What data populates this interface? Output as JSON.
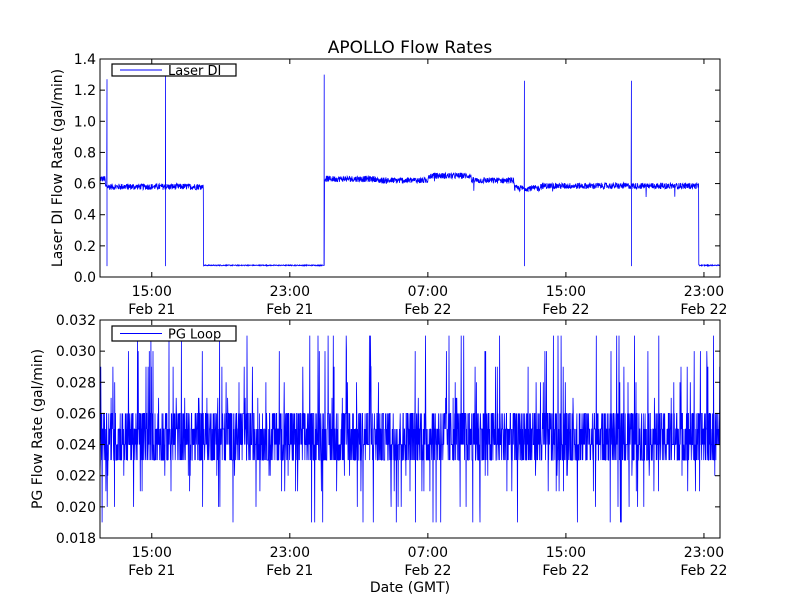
{
  "figure_title": "APOLLO Flow Rates",
  "xlabel": "Date (GMT)",
  "colors": {
    "series": "#0000ff",
    "axes": "#000000",
    "background": "#ffffff"
  },
  "chart_data": [
    {
      "type": "line",
      "title": "APOLLO Flow Rates",
      "ylabel": "Laser DI Flow Rate (gal/min)",
      "legend": {
        "label": "Laser DI",
        "placement": "top-left"
      },
      "xlim_hours": [
        0,
        35.93
      ],
      "x_origin": "Feb 21 12:00",
      "ylim": [
        0.0,
        1.4
      ],
      "yticks": [
        "0.0",
        "0.2",
        "0.4",
        "0.6",
        "0.8",
        "1.0",
        "1.2",
        "1.4"
      ],
      "ytick_values": [
        0,
        0.2,
        0.4,
        0.6,
        0.8,
        1.0,
        1.2,
        1.4
      ],
      "xticks": [
        {
          "hour": 3,
          "time": "15:00",
          "date": "Feb 21"
        },
        {
          "hour": 11,
          "time": "23:00",
          "date": "Feb 21"
        },
        {
          "hour": 19,
          "time": "07:00",
          "date": "Feb 22"
        },
        {
          "hour": 27,
          "time": "15:00",
          "date": "Feb 22"
        },
        {
          "hour": 35,
          "time": "23:00",
          "date": "Feb 22"
        }
      ],
      "baseline_segments": [
        {
          "from": 0,
          "to": 0.3,
          "value": 0.63
        },
        {
          "from": 0.3,
          "to": 6.0,
          "value": 0.58
        },
        {
          "from": 6.0,
          "to": 13.0,
          "value": 0.075
        },
        {
          "from": 13.0,
          "to": 16.0,
          "value": 0.63
        },
        {
          "from": 16.0,
          "to": 19.0,
          "value": 0.62
        },
        {
          "from": 19.0,
          "to": 21.5,
          "value": 0.65
        },
        {
          "from": 21.5,
          "to": 24.0,
          "value": 0.62
        },
        {
          "from": 24.0,
          "to": 25.5,
          "value": 0.57
        },
        {
          "from": 25.5,
          "to": 34.7,
          "value": 0.585
        },
        {
          "from": 34.7,
          "to": 35.93,
          "value": 0.075
        }
      ],
      "noise_amplitude": 0.02,
      "spikes": [
        {
          "hour": 0.4,
          "high": 1.27,
          "low": 0.07
        },
        {
          "hour": 3.8,
          "high": 1.3,
          "low": 0.07
        },
        {
          "hour": 13.0,
          "high": 1.3,
          "low": 0.08
        },
        {
          "hour": 24.6,
          "high": 1.26,
          "low": 0.07
        },
        {
          "hour": 30.8,
          "high": 1.26,
          "low": 0.07
        }
      ]
    },
    {
      "type": "line",
      "ylabel": "PG Flow Rate (gal/min)",
      "legend": {
        "label": "PG Loop",
        "placement": "top-left"
      },
      "xlim_hours": [
        0,
        35.93
      ],
      "ylim": [
        0.018,
        0.032
      ],
      "yticks": [
        "0.018",
        "0.020",
        "0.022",
        "0.024",
        "0.026",
        "0.028",
        "0.030",
        "0.032"
      ],
      "ytick_values": [
        0.018,
        0.02,
        0.022,
        0.024,
        0.026,
        0.028,
        0.03,
        0.032
      ],
      "xticks": [
        {
          "hour": 3,
          "time": "15:00",
          "date": "Feb 21"
        },
        {
          "hour": 11,
          "time": "23:00",
          "date": "Feb 21"
        },
        {
          "hour": 19,
          "time": "07:00",
          "date": "Feb 22"
        },
        {
          "hour": 27,
          "time": "15:00",
          "date": "Feb 22"
        },
        {
          "hour": 35,
          "time": "23:00",
          "date": "Feb 22"
        }
      ],
      "typical_levels": [
        0.023,
        0.024,
        0.025,
        0.026
      ],
      "outlier_levels": [
        0.019,
        0.02,
        0.021,
        0.022,
        0.027,
        0.028,
        0.029,
        0.03,
        0.031
      ],
      "outlier_fraction": 0.08
    }
  ]
}
